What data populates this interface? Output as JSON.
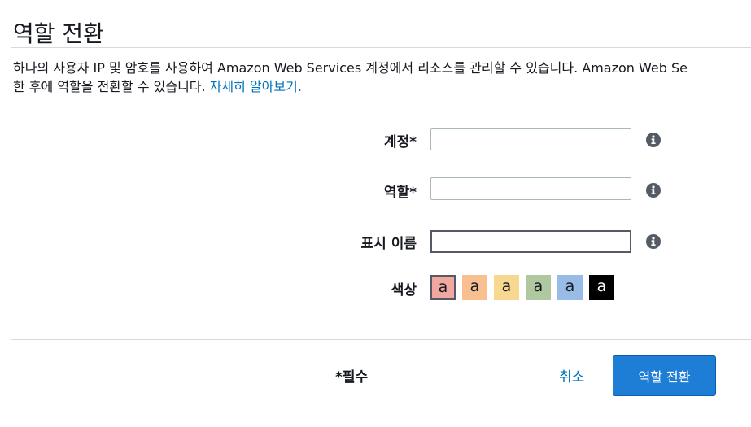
{
  "page": {
    "title": "역할 전환",
    "description_line1": "하나의 사용자 IP 및 암호를 사용하여 Amazon Web Services 계정에서 리소스를 관리할 수 있습니다. Amazon Web Se",
    "description_line2_text": "한 후에 역할을 전환할 수 있습니다. ",
    "learn_more_link": "자세히 알아보기."
  },
  "form": {
    "account_label": "계정*",
    "account_value": "",
    "role_label": "역할*",
    "role_value": "",
    "display_name_label": "표시 이름",
    "display_name_value": "",
    "color_label": "색상",
    "info_icon": "info-icon",
    "colors": [
      {
        "letter": "a",
        "color": "#f0a8a0",
        "selected": true
      },
      {
        "letter": "a",
        "color": "#f8c090",
        "selected": false
      },
      {
        "letter": "a",
        "color": "#f8d890",
        "selected": false
      },
      {
        "letter": "a",
        "color": "#b0c8a0",
        "selected": false
      },
      {
        "letter": "a",
        "color": "#99bce6",
        "selected": false
      },
      {
        "letter": "a",
        "color": "#000000",
        "text_color": "#ffffff",
        "selected": false
      }
    ]
  },
  "footer": {
    "required_note": "*필수",
    "cancel_label": "취소",
    "submit_label": "역할 전환"
  }
}
